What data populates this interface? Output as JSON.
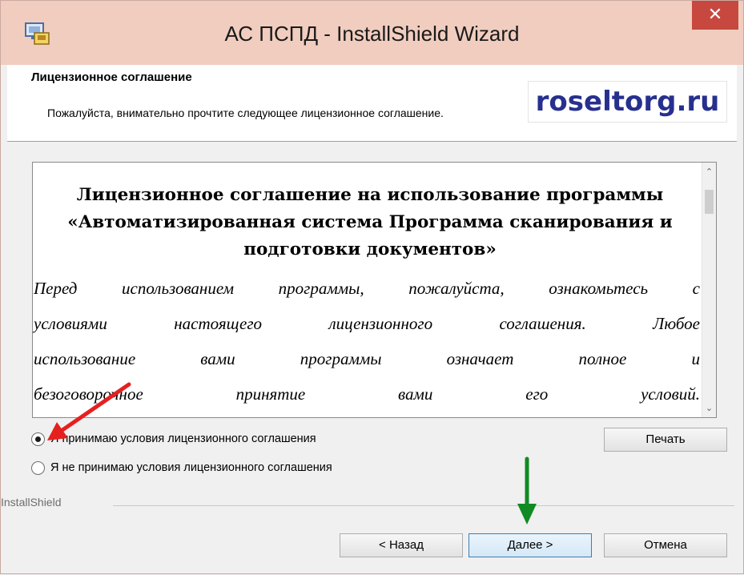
{
  "window": {
    "title": "АС ПСПД - InstallShield Wizard",
    "close_glyph": "✕",
    "app_icon": "installer-icon"
  },
  "banner": {
    "title": "Лицензионное соглашение",
    "subtitle": "Пожалуйста, внимательно прочтите следующее лицензионное соглашение.",
    "watermark": "roseltorg.ru"
  },
  "license": {
    "heading_lines": [
      "Лицензионное соглашение на использование программы",
      "«Автоматизированная система Программа сканирования и",
      "подготовки документов»"
    ],
    "body_lines": [
      "Перед использованием программы, пожалуйста, ознакомьтесь с",
      "условиями настоящего лицензионного соглашения. Любое",
      "использование вами программы означает полное и",
      "безоговорочное принятие вами его условий."
    ],
    "scroll_up_glyph": "⌃",
    "scroll_down_glyph": "⌄"
  },
  "options": {
    "accept_label": "Я принимаю условия лицензионного соглашения",
    "decline_label": "Я не принимаю условия лицензионного соглашения",
    "selected": "accept"
  },
  "buttons": {
    "print": "Печать",
    "back": "< Назад",
    "next": "Далее >",
    "cancel": "Отмена"
  },
  "footer": {
    "brand": "InstallShield"
  },
  "colors": {
    "titlebar": "#f1cdbf",
    "close": "#c7483f",
    "watermark_text": "#27308e",
    "red_arrow": "#e5201f",
    "green_arrow": "#128a23"
  }
}
